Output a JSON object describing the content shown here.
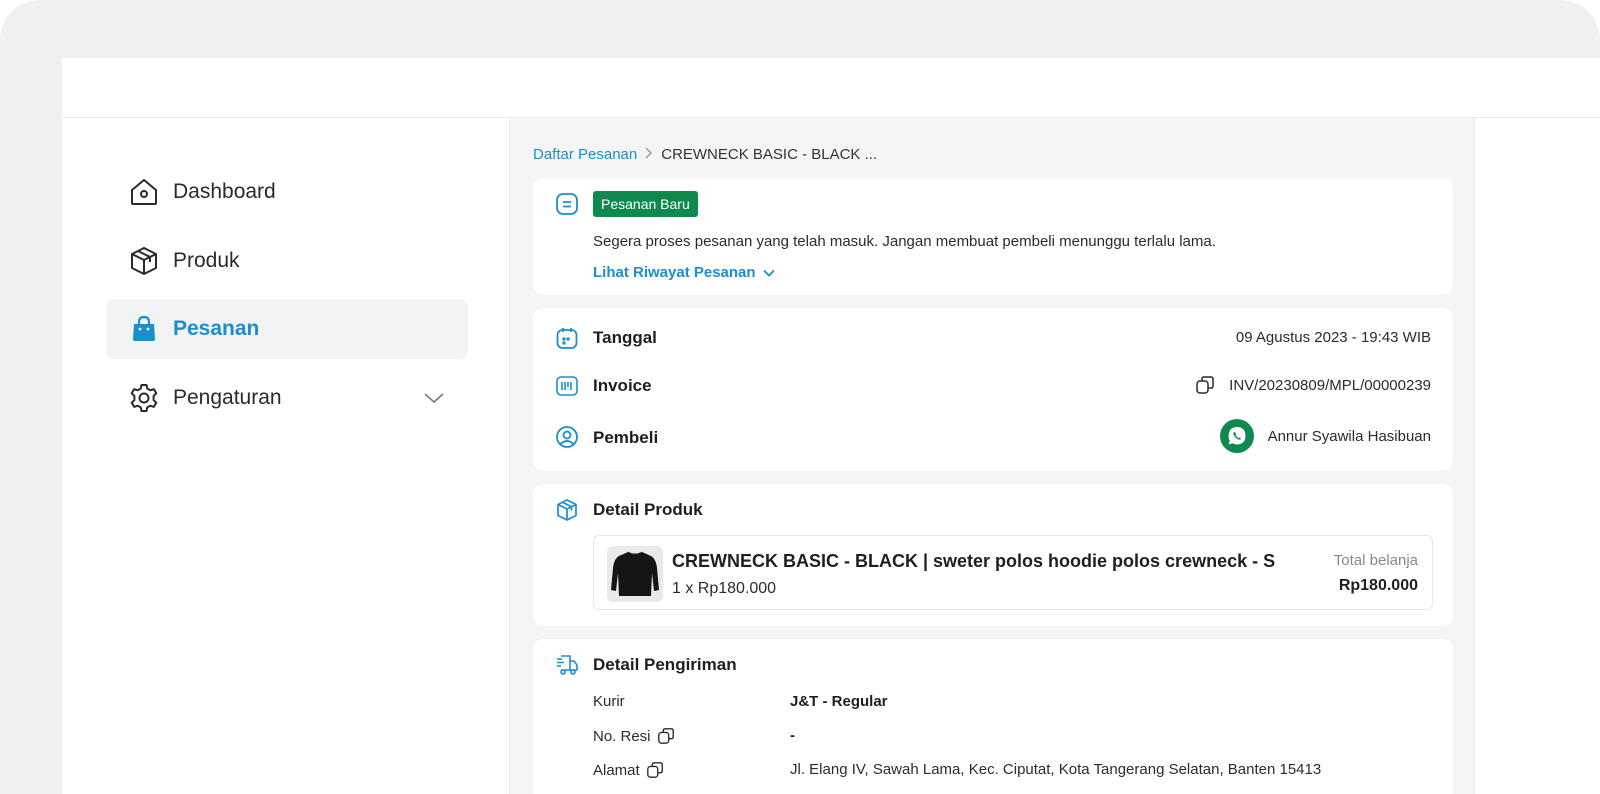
{
  "sidebar": {
    "items": [
      {
        "label": "Dashboard",
        "icon": "home-icon"
      },
      {
        "label": "Produk",
        "icon": "box-icon"
      },
      {
        "label": "Pesanan",
        "icon": "shopping-bag-icon",
        "active": true
      },
      {
        "label": "Pengaturan",
        "icon": "gear-icon",
        "has_submenu": true
      }
    ]
  },
  "breadcrumb": {
    "parent": "Daftar Pesanan",
    "current": "CREWNECK BASIC - BLACK ..."
  },
  "status": {
    "badge": "Pesanan Baru",
    "message": "Segera proses pesanan yang telah masuk. Jangan membuat pembeli menunggu terlalu lama.",
    "history_link": "Lihat Riwayat Pesanan"
  },
  "order": {
    "date_label": "Tanggal",
    "date_value": "09 Agustus 2023 - 19:43 WIB",
    "invoice_label": "Invoice",
    "invoice_value": "INV/20230809/MPL/00000239",
    "buyer_label": "Pembeli",
    "buyer_value": "Annur Syawila Hasibuan"
  },
  "product": {
    "section_title": "Detail Produk",
    "name": "CREWNECK BASIC - BLACK | sweter polos hoodie polos crewneck - S",
    "qty_price": "1 x Rp180.000",
    "total_label": "Total belanja",
    "total_value": "Rp180.000"
  },
  "shipping": {
    "section_title": "Detail Pengiriman",
    "courier_label": "Kurir",
    "courier_value": "J&T - Regular",
    "tracking_label": "No. Resi",
    "tracking_value": "-",
    "address_label": "Alamat",
    "address_value": "Jl. Elang IV, Sawah Lama, Kec. Ciputat, Kota Tangerang Selatan, Banten 15413"
  },
  "colors": {
    "accent": "#1b8fcb",
    "success": "#0e8a4f",
    "background": "#f5f5f5"
  }
}
